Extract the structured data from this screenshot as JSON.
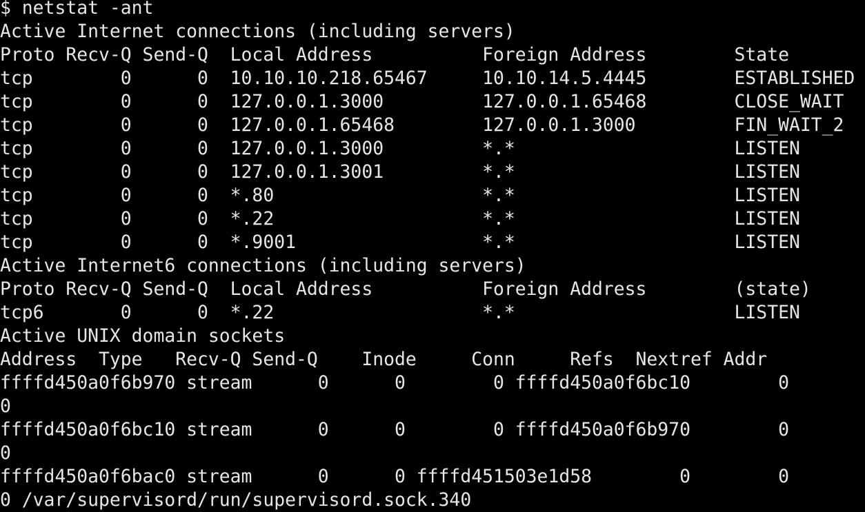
{
  "terminal": {
    "lines": [
      "$ netstat -ant",
      "Active Internet connections (including servers)",
      "Proto Recv-Q Send-Q  Local Address          Foreign Address        State",
      "tcp        0      0  10.10.10.218.65467     10.10.14.5.4445        ESTABLISHED",
      "tcp        0      0  127.0.0.1.3000         127.0.0.1.65468        CLOSE_WAIT",
      "tcp        0      0  127.0.0.1.65468        127.0.0.1.3000         FIN_WAIT_2",
      "tcp        0      0  127.0.0.1.3000         *.*                    LISTEN",
      "tcp        0      0  127.0.0.1.3001         *.*                    LISTEN",
      "tcp        0      0  *.80                   *.*                    LISTEN",
      "tcp        0      0  *.22                   *.*                    LISTEN",
      "tcp        0      0  *.9001                 *.*                    LISTEN",
      "Active Internet6 connections (including servers)",
      "Proto Recv-Q Send-Q  Local Address          Foreign Address        (state)",
      "tcp6       0      0  *.22                   *.*                    LISTEN",
      "Active UNIX domain sockets",
      "Address  Type   Recv-Q Send-Q    Inode     Conn     Refs  Nextref Addr",
      "ffffd450a0f6b970 stream      0      0        0 ffffd450a0f6bc10        0",
      "0",
      "ffffd450a0f6bc10 stream      0      0        0 ffffd450a0f6b970        0",
      "0",
      "ffffd450a0f6bac0 stream      0      0 ffffd451503e1d58        0        0",
      "0 /var/supervisord/run/supervisord.sock.340"
    ]
  }
}
